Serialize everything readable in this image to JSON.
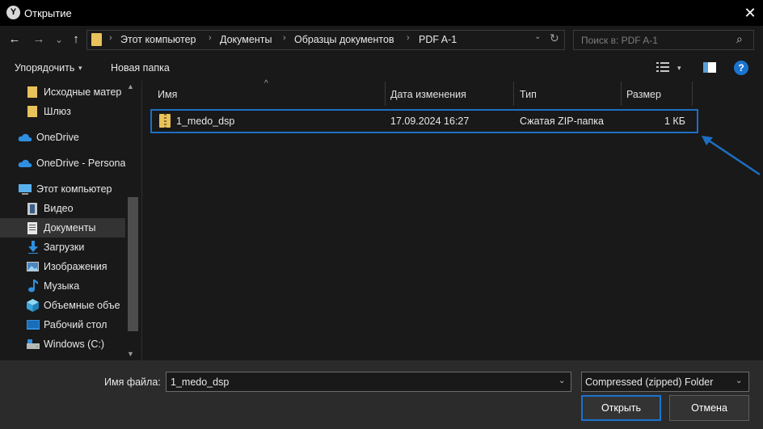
{
  "window": {
    "title": "Открытие",
    "app_icon_letter": "Y",
    "close_glyph": "✕"
  },
  "nav": {
    "back": "←",
    "forward": "→",
    "recent": "⌄",
    "up": "↑",
    "breadcrumb": [
      "Этот компьютер",
      "Документы",
      "Образцы документов",
      "PDF A-1"
    ],
    "separator": "›",
    "dropdown": "⌄",
    "refresh": "↻",
    "search_placeholder": "Поиск в: PDF A-1",
    "search_icon": "⌕"
  },
  "toolbar": {
    "organize_label": "Упорядочить",
    "organize_caret": "▾",
    "new_folder_label": "Новая папка",
    "view_caret": "▾",
    "help_label": "?"
  },
  "sidebar": {
    "items": [
      {
        "label": "Исходные матер",
        "icon": "folder-icon"
      },
      {
        "label": "Шлюз",
        "icon": "folder-icon"
      },
      {
        "label": "OneDrive",
        "icon": "cloud-icon"
      },
      {
        "label": "OneDrive - Persona",
        "icon": "cloud-icon"
      },
      {
        "label": "Этот компьютер",
        "icon": "computer-icon"
      },
      {
        "label": "Видео",
        "icon": "video-icon"
      },
      {
        "label": "Документы",
        "icon": "documents-icon",
        "selected": true
      },
      {
        "label": "Загрузки",
        "icon": "download-icon"
      },
      {
        "label": "Изображения",
        "icon": "pictures-icon"
      },
      {
        "label": "Музыка",
        "icon": "music-icon"
      },
      {
        "label": "Объемные объе",
        "icon": "3d-objects-icon"
      },
      {
        "label": "Рабочий стол",
        "icon": "desktop-icon"
      },
      {
        "label": "Windows (C:)",
        "icon": "drive-icon"
      }
    ],
    "scroll_up": "▲",
    "scroll_down": "▼"
  },
  "columns": {
    "sort_arrow": "^",
    "name": "Имя",
    "modified": "Дата изменения",
    "type": "Тип",
    "size": "Размер"
  },
  "files": [
    {
      "name": "1_medo_dsp",
      "modified": "17.09.2024 16:27",
      "type": "Сжатая ZIP-папка",
      "size": "1 КБ"
    }
  ],
  "footer": {
    "filename_label": "Имя файла:",
    "filename_value": "1_medo_dsp",
    "filename_dd": "⌄",
    "filetype_value": "Compressed (zipped) Folder",
    "filetype_dd": "⌄",
    "open_label": "Открыть",
    "cancel_label": "Отмена"
  },
  "colors": {
    "accent": "#1a73d0",
    "highlight_border": "#1e6fc2",
    "folder": "#e8c25a"
  }
}
